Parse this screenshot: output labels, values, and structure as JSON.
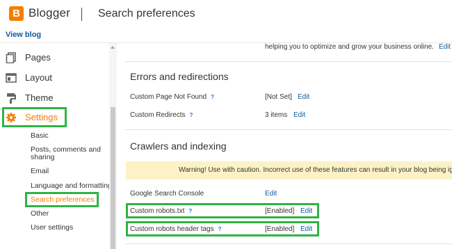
{
  "header": {
    "brand": "Blogger",
    "page_title": "Search preferences",
    "view_blog": "View blog"
  },
  "sidebar": {
    "items": [
      {
        "label": "Pages",
        "icon": "pages-icon"
      },
      {
        "label": "Layout",
        "icon": "layout-icon"
      },
      {
        "label": "Theme",
        "icon": "theme-icon"
      },
      {
        "label": "Settings",
        "icon": "gear-icon",
        "active": true
      }
    ],
    "settings_sub": [
      "Basic",
      "Posts, comments and",
      "sharing",
      "Email",
      "Language and formatting",
      "Search preferences",
      "Other",
      "User settings"
    ]
  },
  "main": {
    "snippet_text": "helping you to optimize and grow your business online.",
    "snippet_edit": "Edit",
    "errors": {
      "title": "Errors and redirections",
      "rows": [
        {
          "label": "Custom Page Not Found",
          "help": "?",
          "value": "[Not Set]",
          "edit": "Edit"
        },
        {
          "label": "Custom Redirects",
          "help": "?",
          "value": "3 items",
          "edit": "Edit"
        }
      ]
    },
    "crawlers": {
      "title": "Crawlers and indexing",
      "warning": "Warning! Use with caution. Incorrect use of these features can result in your blog being ignored",
      "rows": [
        {
          "label": "Google Search Console",
          "value": "",
          "edit": "Edit"
        },
        {
          "label": "Custom robots.txt",
          "help": "?",
          "value": "[Enabled]",
          "edit": "Edit"
        },
        {
          "label": "Custom robots header tags",
          "help": "?",
          "value": "[Enabled]",
          "edit": "Edit"
        }
      ]
    }
  },
  "colors": {
    "brand_orange": "#f57d00",
    "link_blue": "#0c5ba0",
    "highlight_green": "#2fb344",
    "warning_bg": "#fdf2c6"
  }
}
